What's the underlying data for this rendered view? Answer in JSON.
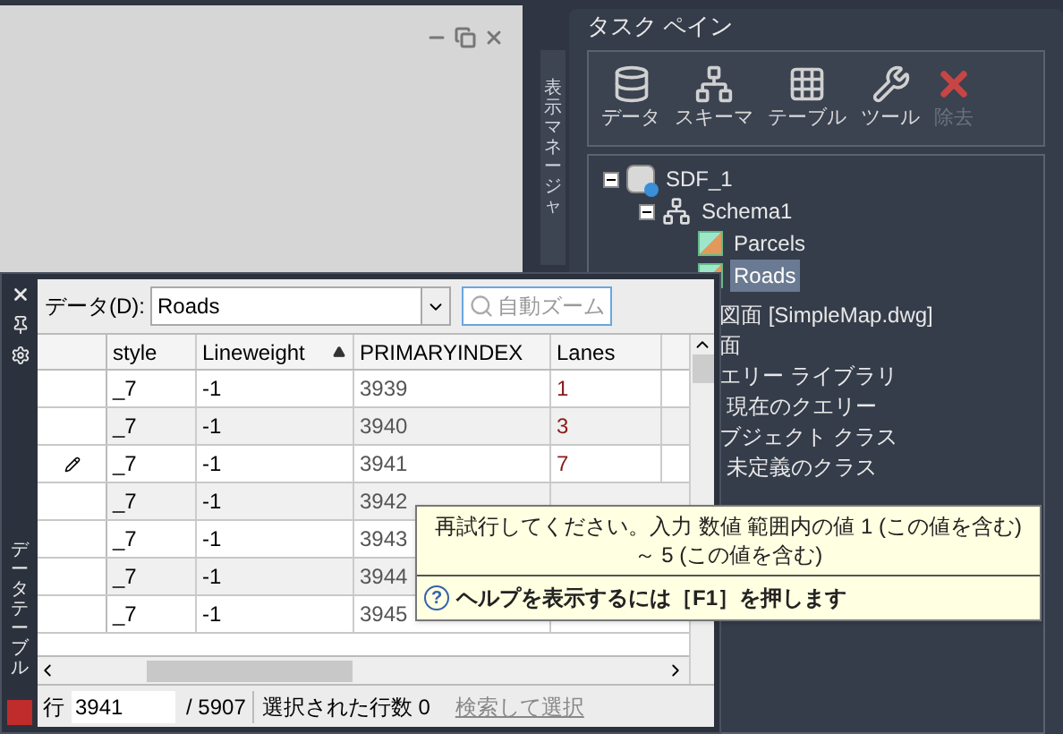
{
  "display_manager_tab": {
    "label": "表示マネージャ"
  },
  "task_pane": {
    "title": "タスク ペイン",
    "toolbar": [
      {
        "label": "データ",
        "disabled": false
      },
      {
        "label": "スキーマ",
        "disabled": false
      },
      {
        "label": "テーブル",
        "disabled": false
      },
      {
        "label": "ツール",
        "disabled": false
      },
      {
        "label": "除去",
        "disabled": true
      }
    ],
    "tree": [
      {
        "label": "SDF_1",
        "kind": "source",
        "expanded": true,
        "children": [
          {
            "label": "Schema1",
            "kind": "schema",
            "expanded": true,
            "children": [
              {
                "label": "Parcels",
                "kind": "class",
                "selected": false
              },
              {
                "label": "Roads",
                "kind": "class",
                "selected": true
              }
            ]
          }
        ]
      }
    ],
    "more_items": [
      {
        "label": "図面 [SimpleMap.dwg]",
        "indent": false
      },
      {
        "label": "面",
        "indent": false
      },
      {
        "label": "エリー ライブラリ",
        "indent": false
      },
      {
        "label": "現在のクエリー",
        "indent": true
      },
      {
        "label": "ブジェクト クラス",
        "indent": false
      },
      {
        "label": "未定義のクラス",
        "indent": true
      }
    ]
  },
  "data_table": {
    "title": "データテーブル",
    "data_label": "データ(D):",
    "data_value": "Roads",
    "zoom_button": {
      "label": "自動ズーム",
      "disabled": true
    },
    "columns": [
      {
        "label": "style",
        "sorted": false
      },
      {
        "label": "Lineweight",
        "sorted": true
      },
      {
        "label": "PRIMARYINDEX",
        "sorted": false
      },
      {
        "label": "Lanes",
        "sorted": false
      }
    ],
    "rows": [
      {
        "editing": false,
        "cells": [
          "_7",
          "-1",
          "3939",
          "1"
        ]
      },
      {
        "editing": false,
        "cells": [
          "_7",
          "-1",
          "3940",
          "3"
        ]
      },
      {
        "editing": true,
        "cells": [
          "_7",
          "-1",
          "3941",
          "7"
        ]
      },
      {
        "editing": false,
        "cells": [
          "_7",
          "-1",
          "3942"
        ]
      },
      {
        "editing": false,
        "cells": [
          "_7",
          "-1",
          "3943"
        ]
      },
      {
        "editing": false,
        "cells": [
          "_7",
          "-1",
          "3944"
        ]
      },
      {
        "editing": false,
        "cells": [
          "_7",
          "-1",
          "3945"
        ]
      }
    ],
    "status": {
      "row_label": "行",
      "row_value": "3941",
      "total": "/ 5907",
      "selected_count": "選択された行数 0",
      "select_link": "検索して選択"
    }
  },
  "tooltip": {
    "message": "再試行してください。入力 数値 範囲内の値 1 (この値を含む) ～ 5 (この値を含む)",
    "help": "ヘルプを表示するには［F1］を押します",
    "help_glyph": "?"
  }
}
